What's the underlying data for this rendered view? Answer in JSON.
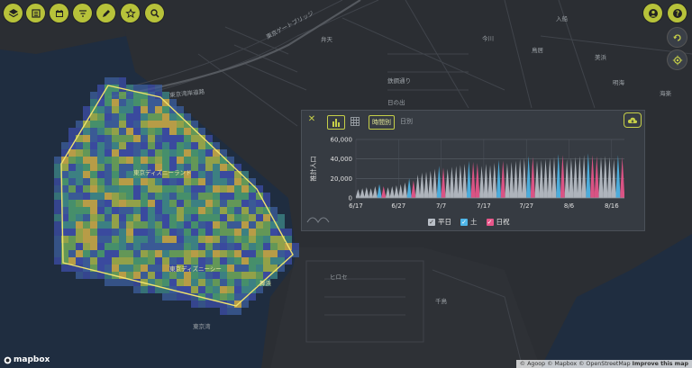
{
  "toolbar": {
    "left": [
      {
        "icon": "layers-icon"
      },
      {
        "icon": "list-icon"
      },
      {
        "icon": "calendar-icon"
      },
      {
        "icon": "filter-icon"
      },
      {
        "icon": "pencil-icon"
      },
      {
        "icon": "star-icon"
      },
      {
        "icon": "search-icon"
      }
    ],
    "right": [
      {
        "icon": "user-icon"
      },
      {
        "icon": "help-icon"
      }
    ],
    "map_controls": [
      {
        "icon": "rotate-icon"
      },
      {
        "icon": "locate-icon"
      }
    ]
  },
  "map": {
    "labels": [
      {
        "text": "東京ゲートブリッジ"
      },
      {
        "text": "弁天"
      },
      {
        "text": "今川"
      },
      {
        "text": "鳥居"
      },
      {
        "text": "明海"
      },
      {
        "text": "東京湾岸道路"
      },
      {
        "text": "日の出"
      },
      {
        "text": "東京ディズニーランド"
      },
      {
        "text": "東京ディズニーシー"
      },
      {
        "text": "舞浜"
      },
      {
        "text": "ヒロセ"
      },
      {
        "text": "千鳥"
      },
      {
        "text": "東京湾"
      },
      {
        "text": "鉄鋼通り"
      },
      {
        "text": "入船"
      },
      {
        "text": "美浜"
      },
      {
        "text": "海楽"
      }
    ]
  },
  "panel": {
    "close_label": "✕",
    "tab_hourly": "時間別",
    "tab_daily": "日別",
    "ylabel": "推計人口",
    "legend": {
      "weekday": "平日",
      "saturday": "土",
      "holiday": "日祝"
    },
    "colors": {
      "weekday": "#b9bfc7",
      "saturday": "#4fb6e8",
      "holiday": "#e8568a",
      "accent": "#c6cf48"
    }
  },
  "chart_data": {
    "type": "area",
    "title": "",
    "xlabel": "",
    "ylabel": "推計人口",
    "ylim": [
      0,
      60000
    ],
    "yticks": [
      "0",
      "20,000",
      "40,000",
      "60,000"
    ],
    "xticks": [
      "6/17",
      "6/27",
      "7/7",
      "7/17",
      "7/27",
      "8/6",
      "8/16"
    ],
    "x_range": [
      "6/17",
      "8/16"
    ],
    "daily_peak": [
      {
        "date": "6/17",
        "type": "weekday",
        "peak": 9000
      },
      {
        "date": "6/18",
        "type": "weekday",
        "peak": 10000
      },
      {
        "date": "6/19",
        "type": "weekday",
        "peak": 11000
      },
      {
        "date": "6/20",
        "type": "weekday",
        "peak": 10000
      },
      {
        "date": "6/21",
        "type": "weekday",
        "peak": 12000
      },
      {
        "date": "6/22",
        "type": "saturday",
        "peak": 14000
      },
      {
        "date": "6/23",
        "type": "holiday",
        "peak": 12000
      },
      {
        "date": "6/24",
        "type": "weekday",
        "peak": 11000
      },
      {
        "date": "6/25",
        "type": "weekday",
        "peak": 12000
      },
      {
        "date": "6/26",
        "type": "weekday",
        "peak": 13000
      },
      {
        "date": "6/27",
        "type": "weekday",
        "peak": 14000
      },
      {
        "date": "6/28",
        "type": "weekday",
        "peak": 16000
      },
      {
        "date": "6/29",
        "type": "saturday",
        "peak": 20000
      },
      {
        "date": "6/30",
        "type": "holiday",
        "peak": 18000
      },
      {
        "date": "7/1",
        "type": "weekday",
        "peak": 24000
      },
      {
        "date": "7/2",
        "type": "weekday",
        "peak": 26000
      },
      {
        "date": "7/3",
        "type": "weekday",
        "peak": 27000
      },
      {
        "date": "7/4",
        "type": "weekday",
        "peak": 28000
      },
      {
        "date": "7/5",
        "type": "weekday",
        "peak": 30000
      },
      {
        "date": "7/6",
        "type": "saturday",
        "peak": 33000
      },
      {
        "date": "7/7",
        "type": "holiday",
        "peak": 31000
      },
      {
        "date": "7/8",
        "type": "weekday",
        "peak": 30000
      },
      {
        "date": "7/9",
        "type": "weekday",
        "peak": 32000
      },
      {
        "date": "7/10",
        "type": "weekday",
        "peak": 33000
      },
      {
        "date": "7/11",
        "type": "weekday",
        "peak": 34000
      },
      {
        "date": "7/12",
        "type": "weekday",
        "peak": 35000
      },
      {
        "date": "7/13",
        "type": "saturday",
        "peak": 38000
      },
      {
        "date": "7/14",
        "type": "holiday",
        "peak": 37000
      },
      {
        "date": "7/15",
        "type": "holiday",
        "peak": 36000
      },
      {
        "date": "7/16",
        "type": "weekday",
        "peak": 33000
      },
      {
        "date": "7/17",
        "type": "weekday",
        "peak": 35000
      },
      {
        "date": "7/18",
        "type": "weekday",
        "peak": 34000
      },
      {
        "date": "7/19",
        "type": "weekday",
        "peak": 36000
      },
      {
        "date": "7/20",
        "type": "saturday",
        "peak": 39000
      },
      {
        "date": "7/21",
        "type": "holiday",
        "peak": 38000
      },
      {
        "date": "7/22",
        "type": "weekday",
        "peak": 36000
      },
      {
        "date": "7/23",
        "type": "weekday",
        "peak": 37000
      },
      {
        "date": "7/24",
        "type": "weekday",
        "peak": 38000
      },
      {
        "date": "7/25",
        "type": "weekday",
        "peak": 40000
      },
      {
        "date": "7/26",
        "type": "weekday",
        "peak": 41000
      },
      {
        "date": "7/27",
        "type": "saturday",
        "peak": 43000
      },
      {
        "date": "7/28",
        "type": "holiday",
        "peak": 42000
      },
      {
        "date": "7/29",
        "type": "weekday",
        "peak": 38000
      },
      {
        "date": "7/30",
        "type": "weekday",
        "peak": 39000
      },
      {
        "date": "7/31",
        "type": "weekday",
        "peak": 40000
      },
      {
        "date": "8/1",
        "type": "weekday",
        "peak": 41000
      },
      {
        "date": "8/2",
        "type": "weekday",
        "peak": 42000
      },
      {
        "date": "8/3",
        "type": "saturday",
        "peak": 45000
      },
      {
        "date": "8/4",
        "type": "holiday",
        "peak": 44000
      },
      {
        "date": "8/5",
        "type": "weekday",
        "peak": 40000
      },
      {
        "date": "8/6",
        "type": "weekday",
        "peak": 41000
      },
      {
        "date": "8/7",
        "type": "weekday",
        "peak": 42000
      },
      {
        "date": "8/8",
        "type": "weekday",
        "peak": 43000
      },
      {
        "date": "8/9",
        "type": "weekday",
        "peak": 44000
      },
      {
        "date": "8/10",
        "type": "saturday",
        "peak": 46000
      },
      {
        "date": "8/11",
        "type": "holiday",
        "peak": 44000
      },
      {
        "date": "8/12",
        "type": "holiday",
        "peak": 43000
      },
      {
        "date": "8/13",
        "type": "weekday",
        "peak": 42000
      },
      {
        "date": "8/14",
        "type": "weekday",
        "peak": 43000
      },
      {
        "date": "8/15",
        "type": "weekday",
        "peak": 42000
      },
      {
        "date": "8/16",
        "type": "weekday",
        "peak": 40000
      },
      {
        "date": "8/17",
        "type": "saturday",
        "peak": 44000
      },
      {
        "date": "8/18",
        "type": "holiday",
        "peak": 42000
      }
    ]
  },
  "attribution": {
    "logo": "mapbox",
    "agoop": "© Agoop",
    "mapbox": "© Mapbox",
    "osm": "© OpenStreetMap",
    "improve": "Improve this map"
  }
}
